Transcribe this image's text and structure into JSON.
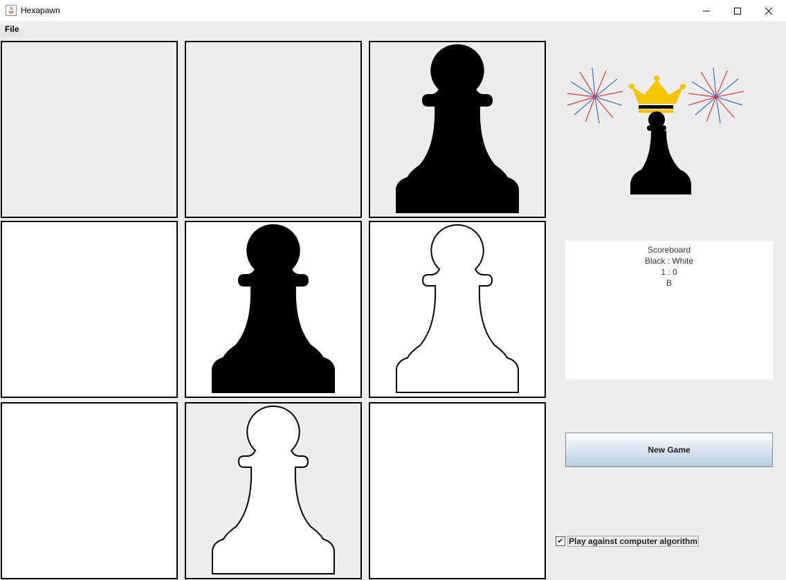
{
  "window": {
    "title": "Hexapawn",
    "controls": [
      "minimize-icon",
      "maximize-icon",
      "close-icon"
    ]
  },
  "menu": {
    "items": [
      {
        "label": "File"
      }
    ]
  },
  "board": {
    "rows": [
      [
        {
          "bg": "grey",
          "piece": "none"
        },
        {
          "bg": "grey",
          "piece": "none"
        },
        {
          "bg": "grey",
          "piece": "black-pawn"
        }
      ],
      [
        {
          "bg": "white",
          "piece": "none"
        },
        {
          "bg": "white",
          "piece": "black-pawn"
        },
        {
          "bg": "white",
          "piece": "white-pawn"
        }
      ],
      [
        {
          "bg": "white",
          "piece": "none"
        },
        {
          "bg": "grey",
          "piece": "white-pawn"
        },
        {
          "bg": "white",
          "piece": "none"
        }
      ]
    ]
  },
  "winner_image": {
    "icon": "crowned-black-pawn-with-fireworks-icon"
  },
  "scoreboard": {
    "title": "Scoreboard",
    "header": "Black : White",
    "score": "1 : 0",
    "winner": "B"
  },
  "new_game": {
    "label": "New Game"
  },
  "computer_option": {
    "label": "Play against computer algorithm",
    "checked": true,
    "check_glyph": "✔"
  },
  "colors": {
    "accent_button": "#b9cbe0",
    "crown": "#f5c400",
    "firework_red": "#e23a3a",
    "firework_blue": "#3a6fd8"
  }
}
